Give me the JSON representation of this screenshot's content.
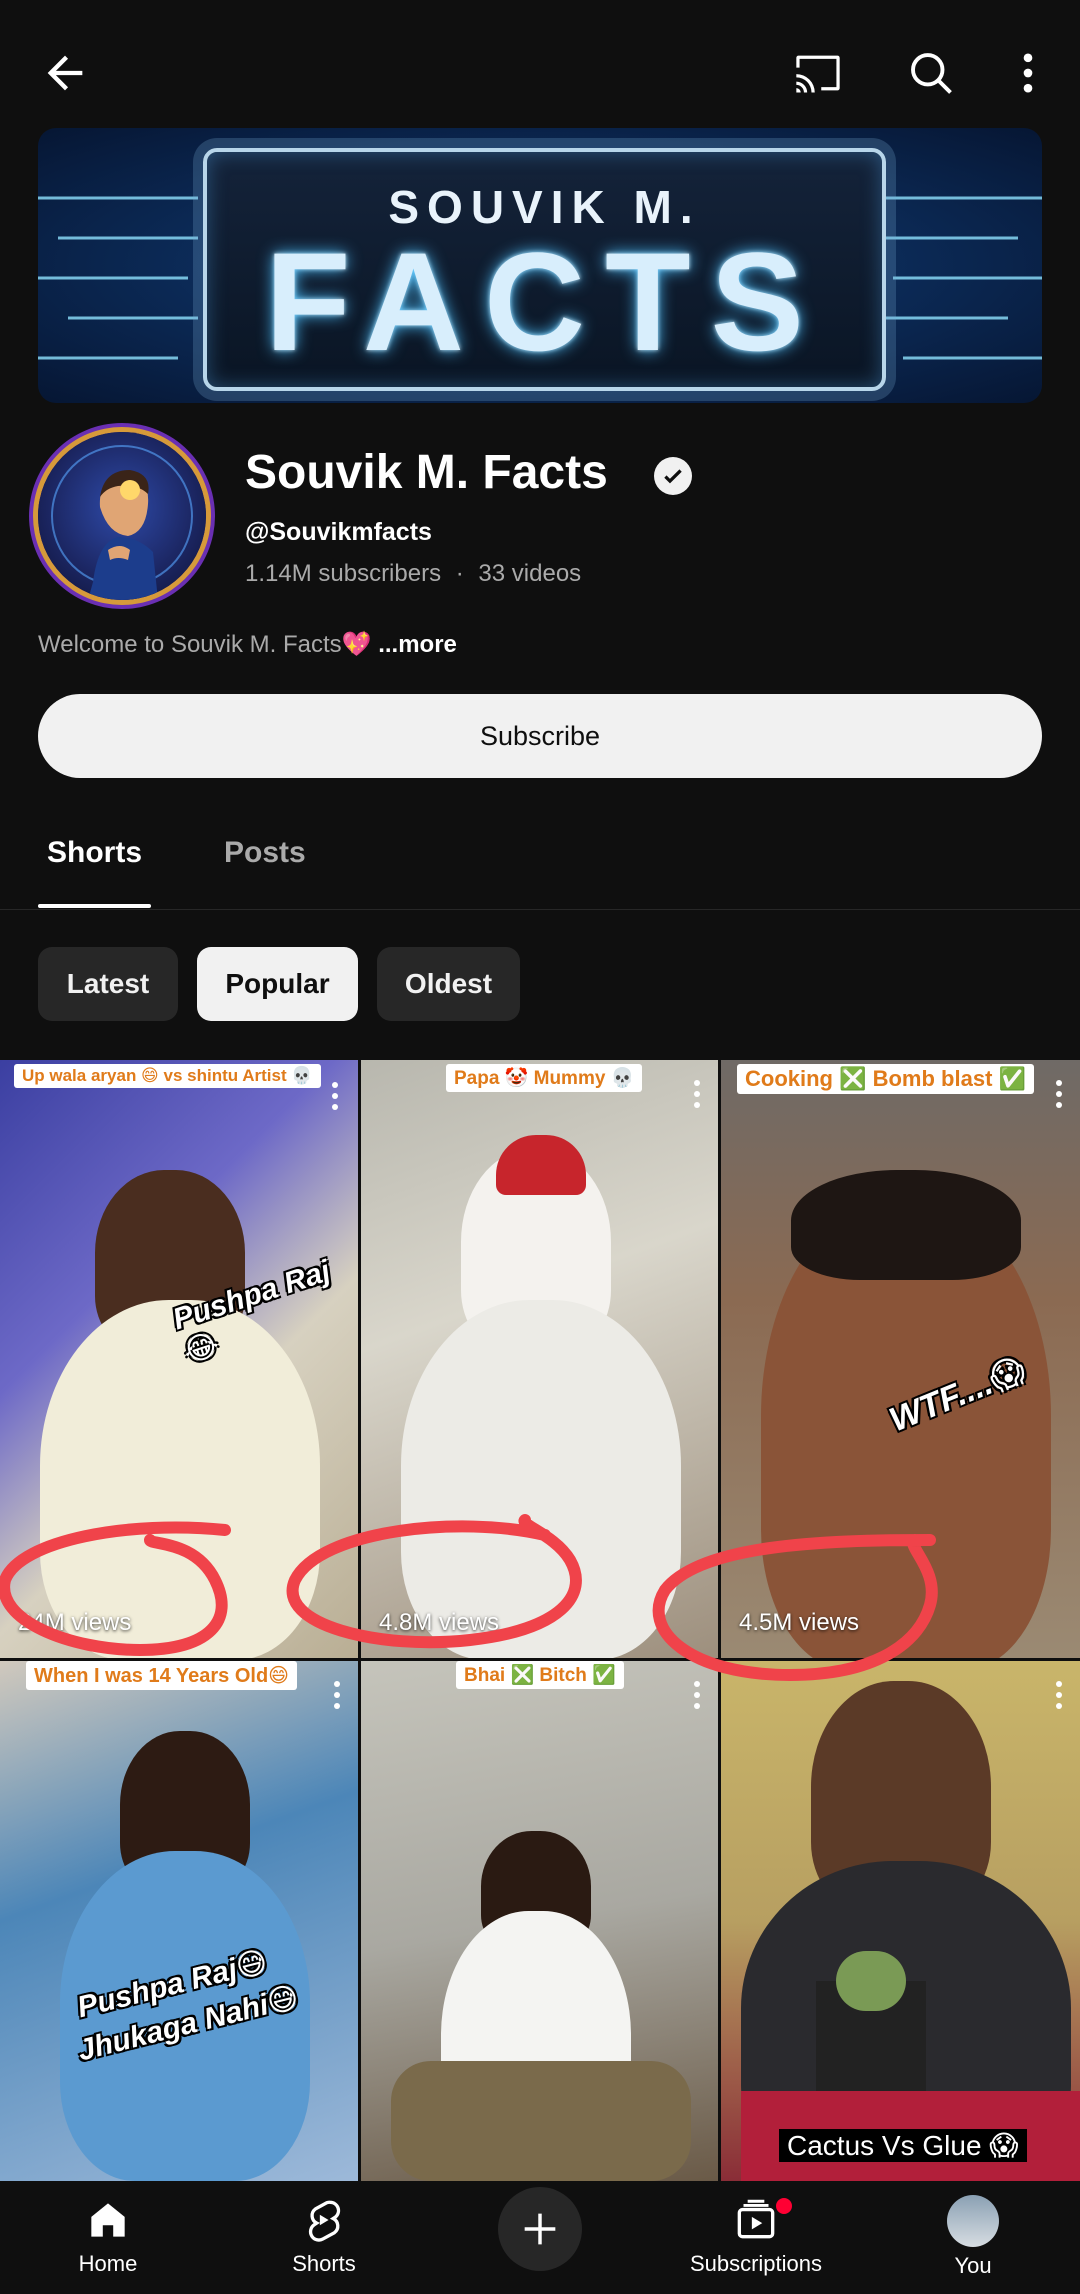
{
  "topbar": {
    "icons": [
      "back-arrow-icon",
      "cast-icon",
      "search-icon",
      "more-vert-icon"
    ]
  },
  "banner": {
    "top_text": "SOUVIK M.",
    "main_text": "FACTS"
  },
  "channel": {
    "name": "Souvik M. Facts",
    "handle": "@Souvikmfacts",
    "subscribers": "1.14M subscribers",
    "separator": "·",
    "videos": "33 videos",
    "description": "Welcome to Souvik M. Facts💖",
    "more_label": "...more",
    "subscribe_label": "Subscribe"
  },
  "tabs": [
    {
      "label": "Shorts",
      "selected": true
    },
    {
      "label": "Posts",
      "selected": false
    }
  ],
  "chips": [
    {
      "label": "Latest",
      "selected": false
    },
    {
      "label": "Popular",
      "selected": true
    },
    {
      "label": "Oldest",
      "selected": false
    }
  ],
  "shorts": [
    {
      "top_caption": "Up wala aryan 😄 vs shintu Artist 💀",
      "overlay": "Pushpa Raj😂",
      "views": "24M views"
    },
    {
      "top_caption": "Papa 🤡 Mummy 💀",
      "overlay": "",
      "views": "4.8M views"
    },
    {
      "top_caption": "Cooking ❎ Bomb blast ✅",
      "overlay": "WTF....😱",
      "views": "4.5M views"
    },
    {
      "top_caption": "When I was 14 Years Old😄",
      "overlay": "Pushpa Raj😅 Jhukaga Nahi😅",
      "overlay_line1": "Pushpa Raj😅",
      "overlay_line2": "Jhukaga Nahi😅",
      "views": ""
    },
    {
      "top_caption": "Bhai ❎ Bitch ✅",
      "overlay": "",
      "views": ""
    },
    {
      "top_caption": "",
      "overlay": "Cactus Vs Glue 😱",
      "views": ""
    }
  ],
  "bottom_nav": [
    {
      "label": "Home",
      "icon": "home-icon"
    },
    {
      "label": "Shorts",
      "icon": "shorts-icon"
    },
    {
      "label": "",
      "icon": "create-plus-icon"
    },
    {
      "label": "Subscriptions",
      "icon": "subscriptions-icon"
    },
    {
      "label": "You",
      "icon": "you-avatar-icon"
    }
  ],
  "colors": {
    "background": "#0f0f0f",
    "chip_bg": "#272727",
    "accent_red": "#ff0033",
    "annotation_red": "#f0434a"
  }
}
